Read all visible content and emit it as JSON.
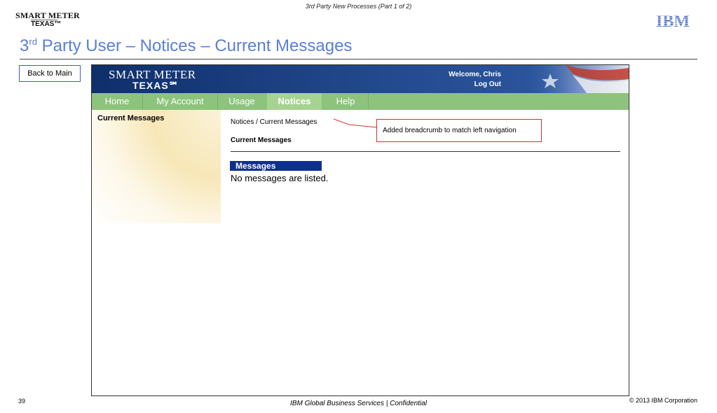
{
  "slide": {
    "top_caption": "3rd Party New Processes (Part 1 of 2)",
    "logo_line1": "SMART METER",
    "logo_line2": "TEXAS™",
    "ibm_logo": "IBM",
    "title_pre": "3",
    "title_sup": "rd",
    "title_post": " Party User – Notices – Current Messages",
    "back_button": "Back to Main",
    "annotation": "Added breadcrumb to match left navigation",
    "slide_number": "39",
    "footer": "IBM Global Business Services |  Confidential",
    "copyright": "© 2013 IBM Corporation"
  },
  "app": {
    "logo_line1": "SMART METER",
    "logo_line2": "TEXAS℠",
    "welcome": "Welcome, Chris",
    "logout": "Log Out",
    "nav": [
      {
        "label": "Home"
      },
      {
        "label": "My Account"
      },
      {
        "label": "Usage"
      },
      {
        "label": "Notices",
        "active": true
      },
      {
        "label": "Help"
      }
    ],
    "sidebar_title": "Current Messages",
    "breadcrumb": "Notices / Current Messages",
    "content_title": "Current Messages",
    "messages_header": "Messages",
    "messages_empty": "No messages are listed."
  },
  "colors": {
    "header_blue": "#1d3f80",
    "nav_green": "#8dc37c",
    "title_blue": "#5b7fd6",
    "annotation_red": "#d43030"
  }
}
